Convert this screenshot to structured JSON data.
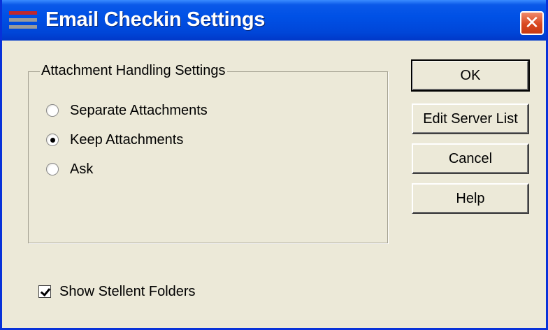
{
  "window": {
    "title": "Email Checkin Settings",
    "close_glyph": "✕",
    "icon": "app-window-icon"
  },
  "group": {
    "legend": "Attachment Handling Settings",
    "options": [
      {
        "label": "Separate Attachments",
        "checked": false
      },
      {
        "label": "Keep Attachments",
        "checked": true
      },
      {
        "label": "Ask",
        "checked": false
      }
    ]
  },
  "checkbox": {
    "label": "Show Stellent Folders",
    "checked": true
  },
  "buttons": {
    "ok": "OK",
    "edit_server_list": "Edit Server List",
    "cancel": "Cancel",
    "help": "Help"
  },
  "colors": {
    "title_bar": "#0046D8",
    "dialog_bg": "#ECE9D8",
    "close_button": "#D9471F",
    "icon_stripe_red": "#C0282D",
    "icon_stripe_gray": "#9A9A9A"
  }
}
